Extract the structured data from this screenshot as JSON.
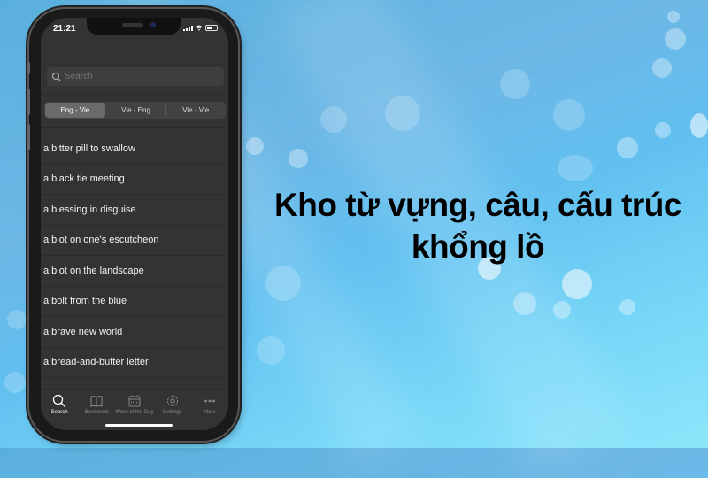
{
  "headline": {
    "line1": "Kho từ vựng, câu, cấu trúc",
    "line2": "khổng lồ"
  },
  "status_bar": {
    "time": "21:21",
    "icons": [
      "cellular-signal-icon",
      "wifi-icon",
      "battery-icon"
    ]
  },
  "search": {
    "placeholder": "Search",
    "value": ""
  },
  "segments": [
    {
      "label": "Eng - Vie",
      "active": true
    },
    {
      "label": "Vie - Eng",
      "active": false
    },
    {
      "label": "Vie - Vie",
      "active": false
    }
  ],
  "entries": [
    "a bitter pill to swallow",
    "a black tie meeting",
    "a blessing in disguise",
    "a blot on one's escutcheon",
    "a blot on the landscape",
    "a bolt from the blue",
    "a brave new world",
    "a bread-and-butter letter"
  ],
  "tabs": [
    {
      "label": "Search",
      "icon": "search-icon",
      "active": true
    },
    {
      "label": "Bookmark",
      "icon": "book-icon",
      "active": false
    },
    {
      "label": "Word of the Day",
      "icon": "calendar-icon",
      "active": false
    },
    {
      "label": "Settings",
      "icon": "gear-icon",
      "active": false
    },
    {
      "label": "More",
      "icon": "more-dots-icon",
      "active": false
    }
  ],
  "colors": {
    "screen_bg": "#333333",
    "active_segment": "#6a6a6a",
    "headline": "#000000"
  }
}
